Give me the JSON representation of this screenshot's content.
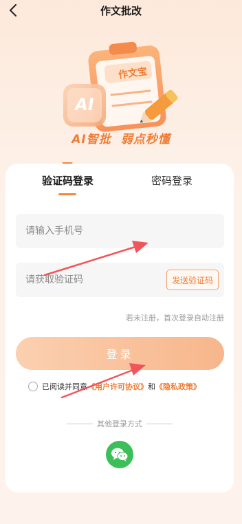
{
  "header": {
    "title": "作文批改",
    "back_icon": "chevron-left-icon"
  },
  "hero": {
    "logo_text": "AI",
    "clipboard_text": "作文宝",
    "slogan_1": "AI智批",
    "slogan_2": "弱点秒懂"
  },
  "tabs": {
    "active": "验证码登录",
    "inactive": "密码登录"
  },
  "form": {
    "phone_placeholder": "请输入手机号",
    "code_placeholder": "请获取验证码",
    "send_code_label": "发送验证码",
    "hint": "若未注册，首次登录自动注册",
    "login_label": "登录"
  },
  "agreement": {
    "prefix": "已阅读并同意",
    "user_agreement": "《用户许可协议》",
    "and": "和",
    "privacy_policy": "《隐私政策》",
    "checked": false
  },
  "other_login": {
    "label": "其他登录方式",
    "wechat_icon": "wechat-icon"
  },
  "colors": {
    "accent": "#f07d35",
    "login_button": "#f7b68b",
    "wechat": "#3cbf59",
    "annotation_arrow": "#f2545b"
  }
}
